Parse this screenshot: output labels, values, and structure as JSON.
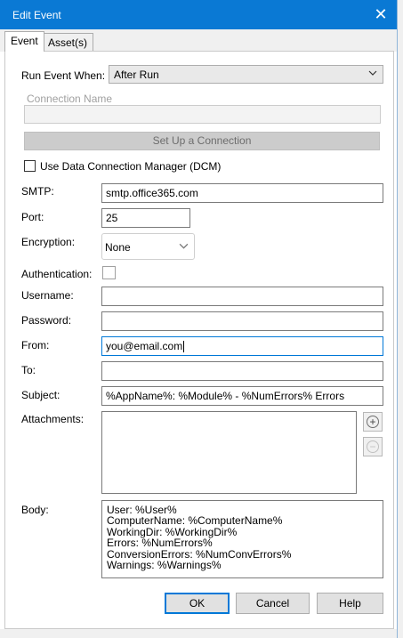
{
  "window": {
    "title": "Edit Event",
    "close_glyph": "✕"
  },
  "tabs": [
    {
      "label": "Event"
    },
    {
      "label": "Asset(s)"
    }
  ],
  "run_event": {
    "label": "Run Event When:",
    "value": "After Run"
  },
  "connection": {
    "label": "Connection Name",
    "value": "",
    "setup_button": "Set Up a Connection"
  },
  "dcm": {
    "label": "Use Data Connection Manager (DCM)",
    "checked": false
  },
  "form": {
    "smtp": {
      "label": "SMTP:",
      "value": "smtp.office365.com"
    },
    "port": {
      "label": "Port:",
      "value": "25"
    },
    "encryption": {
      "label": "Encryption:",
      "value": "None"
    },
    "authentication": {
      "label": "Authentication:",
      "checked": false
    },
    "username": {
      "label": "Username:",
      "value": ""
    },
    "password": {
      "label": "Password:",
      "value": ""
    },
    "from": {
      "label": "From:",
      "value": "you@email.com"
    },
    "to": {
      "label": "To:",
      "value": ""
    },
    "subject": {
      "label": "Subject:",
      "value": "%AppName%: %Module% - %NumErrors% Errors"
    },
    "attachments": {
      "label": "Attachments:",
      "add_glyph": "+",
      "remove_glyph": "−"
    },
    "body": {
      "label": "Body:",
      "value": "User: %User%\nComputerName: %ComputerName%\nWorkingDir: %WorkingDir%\nErrors: %NumErrors%\nConversionErrors: %NumConvErrors%\nWarnings: %Warnings%"
    }
  },
  "buttons": {
    "ok": "OK",
    "cancel": "Cancel",
    "help": "Help"
  },
  "icons": {
    "close": "close-icon",
    "dropdown": "chevron-down-icon",
    "add": "plus-circle-icon",
    "remove": "minus-circle-icon"
  },
  "colors": {
    "titlebar": "#0a79d4",
    "focus": "#0078d7"
  }
}
